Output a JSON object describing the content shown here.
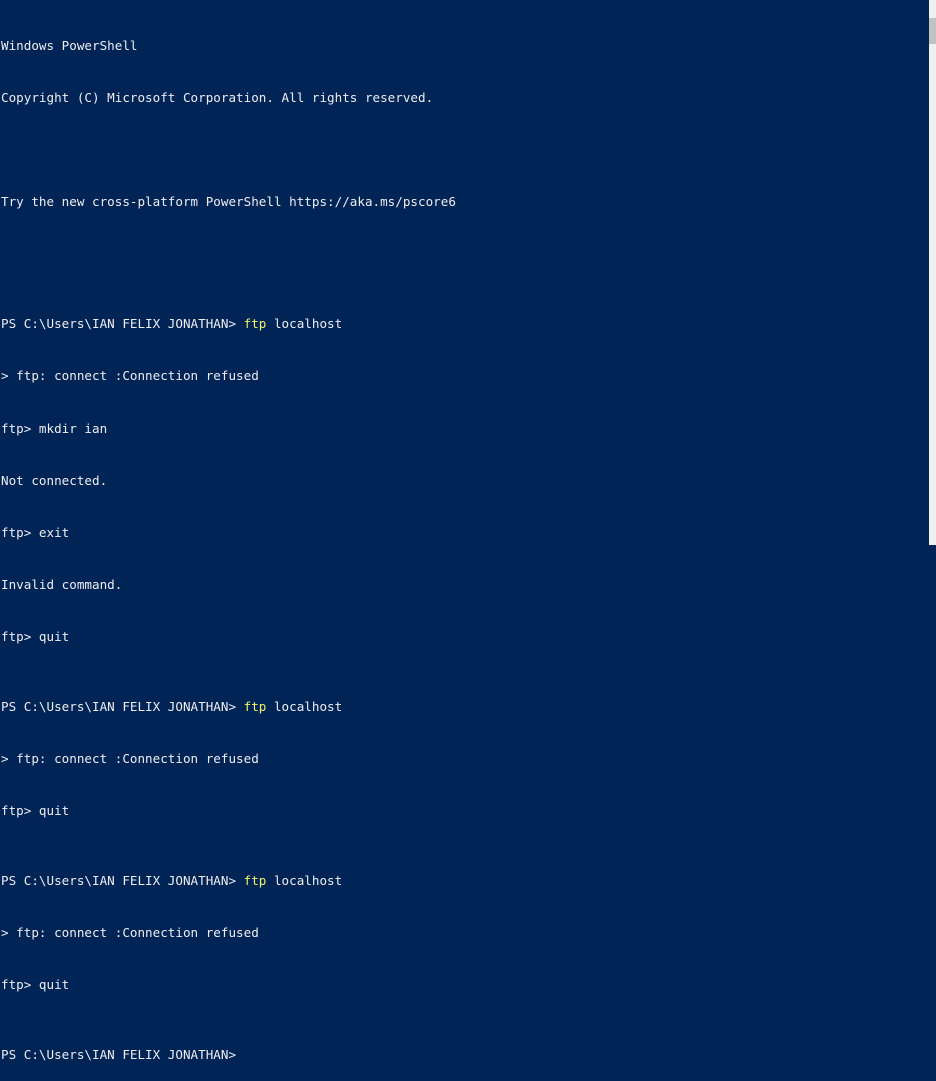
{
  "window": {
    "title_line": "Windows PowerShell",
    "copyright": "Copyright (C) Microsoft Corporation. All rights reserved.",
    "hint": "Try the new cross-platform PowerShell https://aka.ms/pscore6"
  },
  "colors": {
    "background": "#012456",
    "text": "#eeedf0",
    "command": "#f3f36a"
  },
  "session": {
    "prompt": "PS C:\\Users\\IAN FELIX JONATHAN> ",
    "cmd_ftp": "ftp",
    "arg_localhost": " localhost",
    "refused": "> ftp: connect :Connection refused",
    "mkdir": "ftp> mkdir ian",
    "not_connected": "Not connected.",
    "exit": "ftp> exit",
    "invalid": "Invalid command.",
    "quit": "ftp> quit",
    "final_prompt": "PS C:\\Users\\IAN FELIX JONATHAN>"
  }
}
